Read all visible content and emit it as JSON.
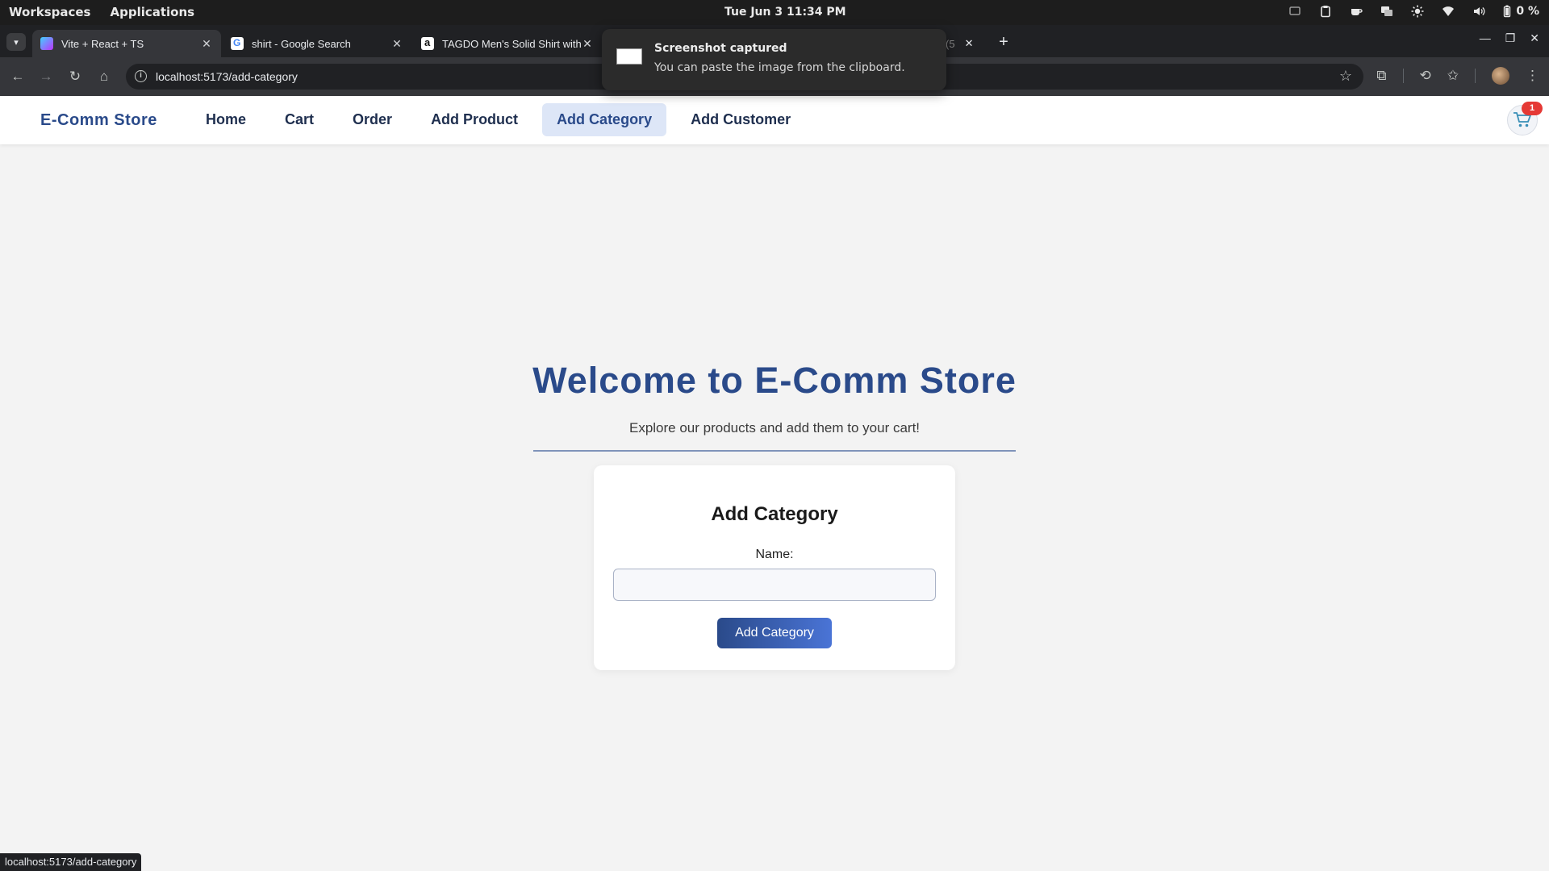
{
  "os": {
    "workspaces": "Workspaces",
    "applications": "Applications",
    "clock": "Tue Jun 3  11:34 PM",
    "battery": "0 %"
  },
  "browser": {
    "tabs": [
      {
        "title": "Vite + React + TS",
        "favicon": "vite-icon"
      },
      {
        "title": "shirt - Google Search",
        "favicon": "google-icon"
      },
      {
        "title": "TAGDO Men's Solid Shirt with",
        "favicon": "amazon-icon"
      }
    ],
    "partial_tab_text": "(5",
    "url": "localhost:5173/add-category",
    "status_url": "localhost:5173/add-category"
  },
  "notification": {
    "title": "Screenshot captured",
    "body": "You can paste the image from the clipboard."
  },
  "navbar": {
    "brand": "E-Comm Store",
    "links": [
      "Home",
      "Cart",
      "Order",
      "Add Product",
      "Add Category",
      "Add Customer"
    ],
    "active_link": "Add Category",
    "cart_count": "1"
  },
  "hero": {
    "title": "Welcome to E-Comm Store",
    "subtitle": "Explore our products and add them to your cart!"
  },
  "form": {
    "title": "Add Category",
    "name_label": "Name:",
    "name_value": "",
    "submit_label": "Add Category"
  },
  "colors": {
    "brand": "#2a4a8a",
    "accent_gradient_end": "#4a74d6",
    "badge": "#e53935"
  }
}
